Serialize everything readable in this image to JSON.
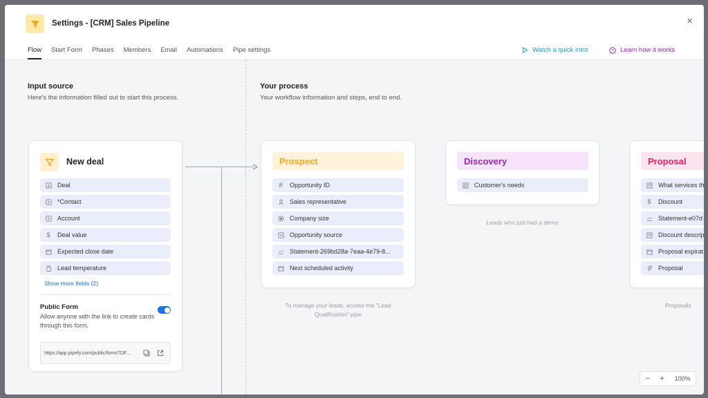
{
  "header": {
    "title": "Settings - [CRM] Sales Pipeline",
    "close_label": "×",
    "tabs": [
      {
        "label": "Flow"
      },
      {
        "label": "Start Form"
      },
      {
        "label": "Phases"
      },
      {
        "label": "Members"
      },
      {
        "label": "Email"
      },
      {
        "label": "Automations"
      },
      {
        "label": "Pipe settings"
      }
    ],
    "watch_label": "Watch a quick intro",
    "learn_label": "Learn how it works"
  },
  "input_source": {
    "title": "Input source",
    "subtitle": "Here's the information filled out to start this process.",
    "card_title": "New deal",
    "fields": [
      {
        "label": "Deal",
        "icon": "text-field-icon"
      },
      {
        "label": "*Contact",
        "icon": "connection-icon"
      },
      {
        "label": "Account",
        "icon": "connection-icon"
      },
      {
        "label": "Deal value",
        "icon": "dollar-icon"
      },
      {
        "label": "Expected close date",
        "icon": "calendar-icon"
      },
      {
        "label": "Lead temperature",
        "icon": "clipboard-icon"
      }
    ],
    "show_more": "Show more fields (2)",
    "public_form_title": "Public Form",
    "public_form_desc_1": "Allow anyone with the link to create cards",
    "public_form_desc_2": "through this form.",
    "public_form_url": "https://app.pipefy.com/public/form/7DF..."
  },
  "process": {
    "title": "Your process",
    "subtitle": "Your workflow information and steps, end to end.",
    "phases": [
      {
        "name": "Prospect",
        "color": "#f5a623",
        "bg": "#fff3dc",
        "fields": [
          {
            "label": "Opportunity ID",
            "icon": "hash-icon"
          },
          {
            "label": "Sales representative",
            "icon": "user-icon"
          },
          {
            "label": "Company size",
            "icon": "radio-icon"
          },
          {
            "label": "Opportunity source",
            "icon": "dropdown-icon"
          },
          {
            "label": "Statement-269bd28a-7eaa-4e79-8...",
            "icon": "statement-icon"
          },
          {
            "label": "Next scheduled activity",
            "icon": "calendar-icon"
          }
        ],
        "caption_1": "To manage your leads, access the \"Lead",
        "caption_2": "Qualification\" pipe"
      },
      {
        "name": "Discovery",
        "color": "#9c27b0",
        "bg": "#f5e4fa",
        "fields": [
          {
            "label": "Customer's needs",
            "icon": "text-area-icon"
          }
        ],
        "caption_1": "Leads who just had a demo",
        "caption_2": ""
      },
      {
        "name": "Proposal",
        "color": "#e91e63",
        "bg": "#fde4ee",
        "fields": [
          {
            "label": "What services th",
            "icon": "text-area-icon"
          },
          {
            "label": "Discount",
            "icon": "dollar-icon"
          },
          {
            "label": "Statement-e07d",
            "icon": "statement-icon"
          },
          {
            "label": "Discount descrip",
            "icon": "text-area-icon"
          },
          {
            "label": "Proposal expirat",
            "icon": "calendar-icon"
          },
          {
            "label": "Proposal",
            "icon": "attachment-icon"
          }
        ],
        "caption_1": "Proposals",
        "caption_2": ""
      }
    ]
  },
  "zoom": {
    "minus": "−",
    "plus": "+",
    "level": "100%"
  }
}
